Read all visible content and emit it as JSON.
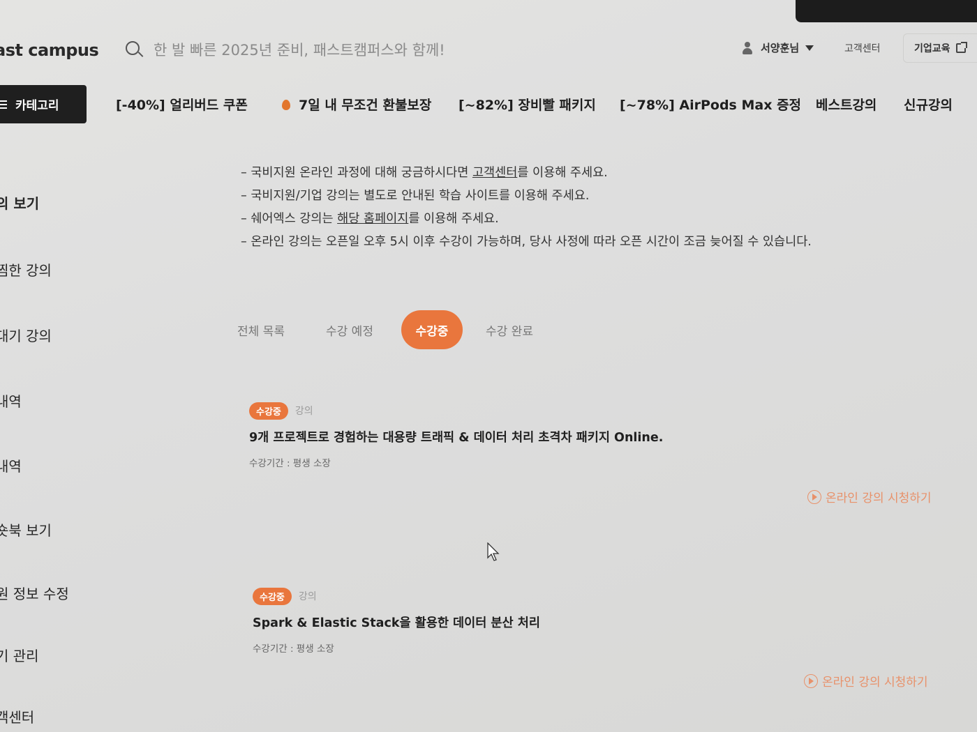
{
  "header": {
    "logo": "ast campus",
    "search_placeholder": "한 발 빠른 2025년 준비, 패스트캠퍼스와 함께!",
    "user_name": "서양훈님",
    "customer_center": "고객센터",
    "corporate": "기업교육"
  },
  "nav": {
    "category": "카테고리",
    "items": [
      "[-40%] 얼리버드 쿠폰",
      "7일 내 무조건 환불보장",
      "[~82%] 장비빨 패키지",
      "[~78%] AirPods Max 증정",
      "베스트강의",
      "신규강의"
    ]
  },
  "sidebar": {
    "items": [
      "의 보기",
      "찜한 강의",
      "대기 강의",
      "내역",
      "내역",
      "숏북 보기",
      "원 정보 수정",
      "기 관리",
      "객센터"
    ]
  },
  "notices": {
    "n1_pre": "– 국비지원 온라인 과정에 대해 궁금하시다면 ",
    "n1_link": "고객센터",
    "n1_post": "를 이용해 주세요.",
    "n2": "– 국비지원/기업 강의는 별도로 안내된 학습 사이트를 이용해 주세요.",
    "n3_pre": "– 쉐어엑스 강의는 ",
    "n3_link": "해당 홈페이지",
    "n3_post": "를 이용해 주세요.",
    "n4": "– 온라인 강의는 오픈일 오후 5시 이후 수강이 가능하며, 당사 사정에 따라 오픈 시간이 조금 늦어질 수 있습니다."
  },
  "tabs": {
    "all": "전체 목록",
    "upcoming": "수강 예정",
    "active": "수강중",
    "done": "수강 완료"
  },
  "courses": [
    {
      "status": "수강중",
      "type": "강의",
      "title": "9개 프로젝트로 경험하는 대용량 트래픽 & 데이터 처리 초격차 패키지 Online.",
      "period": "수강기간 : 평생 소장",
      "action": "온라인 강의 시청하기"
    },
    {
      "status": "수강중",
      "type": "강의",
      "title": "Spark & Elastic Stack을 활용한 데이터 분산 처리",
      "period": "수강기간 : 평생 소장",
      "action": "온라인 강의 시청하기"
    }
  ],
  "colors": {
    "accent": "#e9763d",
    "dark": "#1f1f1f",
    "background": "#dedede"
  }
}
